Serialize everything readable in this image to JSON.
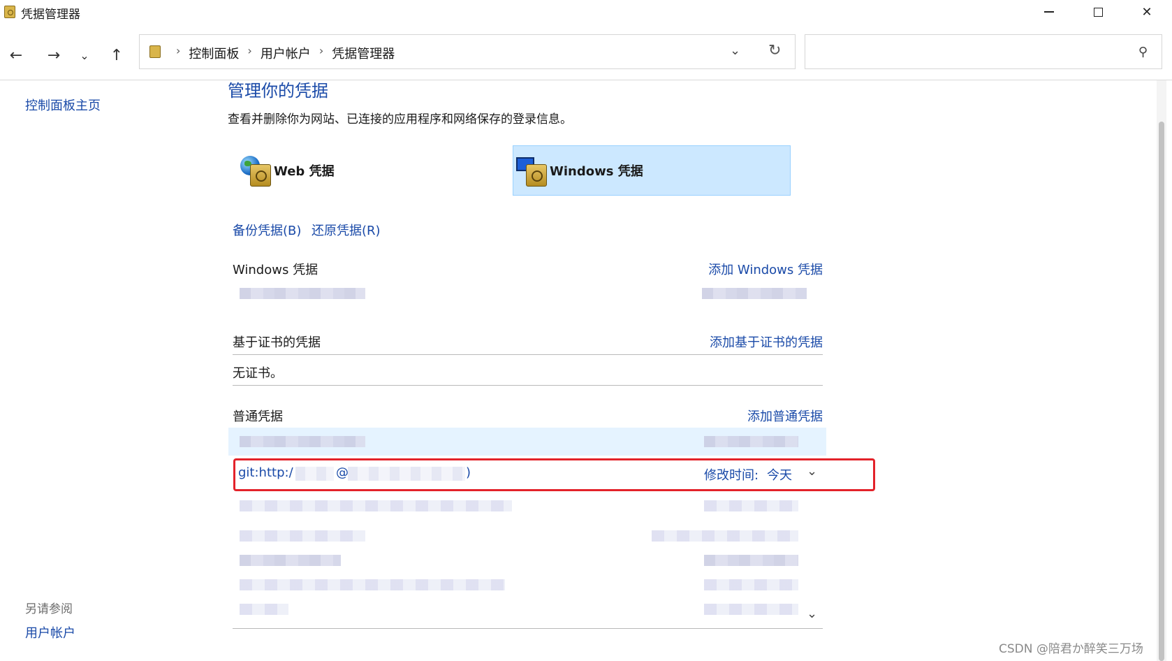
{
  "window": {
    "title": "凭据管理器"
  },
  "nav": {
    "back": "←",
    "forward": "→",
    "recent": "⌄",
    "up": "↑",
    "breadcrumbs": [
      "控制面板",
      "用户帐户",
      "凭据管理器"
    ],
    "sep": "›",
    "dropdown": "⌄",
    "refresh": "↻",
    "search_icon": "⚲"
  },
  "sidebar": {
    "home": "控制面板主页",
    "see_also": "另请参阅",
    "user_accounts": "用户帐户"
  },
  "main": {
    "title": "管理你的凭据",
    "description": "查看并删除你为网站、已连接的应用程序和网络保存的登录信息。",
    "types": [
      {
        "label": "Web 凭据"
      },
      {
        "label": "Windows 凭据",
        "selected": true
      }
    ],
    "backup": "备份凭据(B)",
    "restore": "还原凭据(R)"
  },
  "sections": {
    "windows": {
      "title": "Windows 凭据",
      "add": "添加 Windows 凭据"
    },
    "cert": {
      "title": "基于证书的凭据",
      "add": "添加基于证书的凭据",
      "empty": "无证书。"
    },
    "generic": {
      "title": "普通凭据",
      "add": "添加普通凭据",
      "highlighted": {
        "name_prefix": "git:http:/",
        "at": "@",
        "suffix": ")",
        "modified_label": "修改时间:",
        "modified_value": "今天",
        "expand": "⌄"
      }
    }
  },
  "watermark": "CSDN @陪君か醉笑三万场",
  "colors": {
    "accent": "#1a4aa8",
    "selection": "#cce8ff",
    "highlight_box": "#e3222a"
  }
}
